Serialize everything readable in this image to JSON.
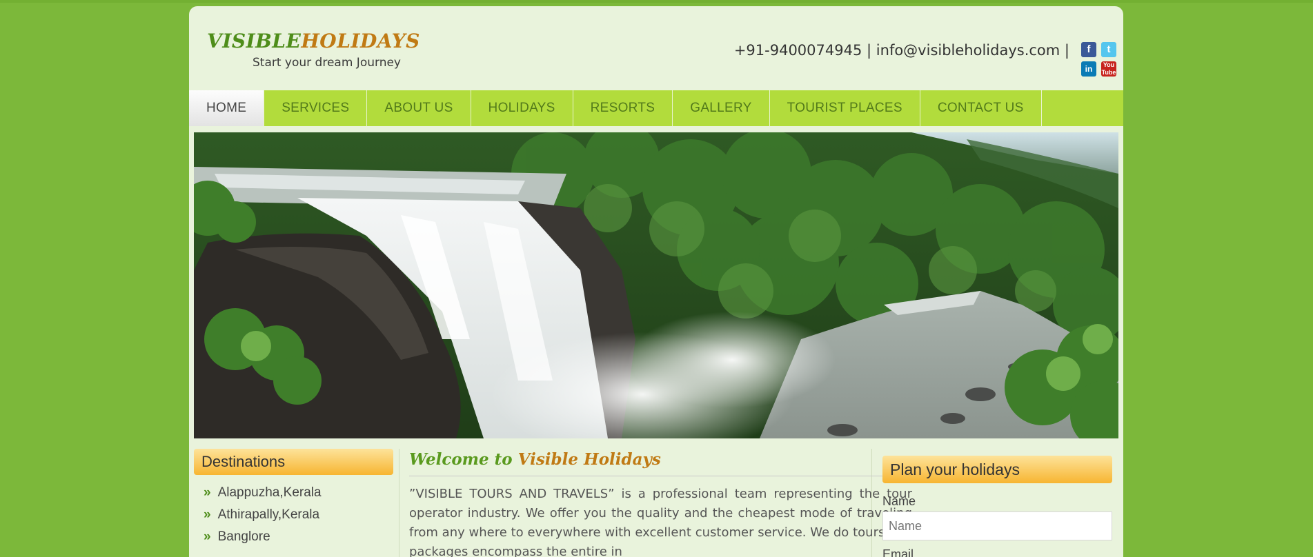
{
  "header": {
    "logo_word1": "VISIBLE",
    "logo_word2": "HOLIDAYS",
    "tagline": "Start your dream Journey",
    "phone": "+91-9400074945",
    "separator": "|",
    "email": "info@visibleholidays.com",
    "social": [
      "facebook-icon",
      "twitter-icon",
      "linkedin-icon",
      "youtube-icon"
    ]
  },
  "nav": {
    "items": [
      "HOME",
      "SERVICES",
      "ABOUT US",
      "HOLIDAYS",
      "RESORTS",
      "GALLERY",
      "TOURIST PLACES",
      "CONTACT US"
    ],
    "active": "HOME"
  },
  "destinations": {
    "title": "Destinations",
    "items": [
      "Alappuzha,Kerala",
      "Athirapally,Kerala",
      "Banglore"
    ]
  },
  "welcome": {
    "title_part1": "Welcome to",
    "title_part2": "Visible Holidays",
    "text": "”VISIBLE TOURS AND TRAVELS” is a professional team representing the tour operator industry. We offer you the quality and the cheapest mode of traveling from any where to everywhere with excellent customer service. We do tours and packages encompass the entire in"
  },
  "plan": {
    "title": "Plan your holidays",
    "name_label": "Name",
    "name_placeholder": "Name",
    "email_label": "Email"
  },
  "colors": {
    "page_bg": "#7cb83a",
    "content_bg": "#e9f3dc",
    "nav_bg": "#b2dc3c",
    "accent_green": "#4e8d1a",
    "accent_orange": "#c07a14"
  }
}
